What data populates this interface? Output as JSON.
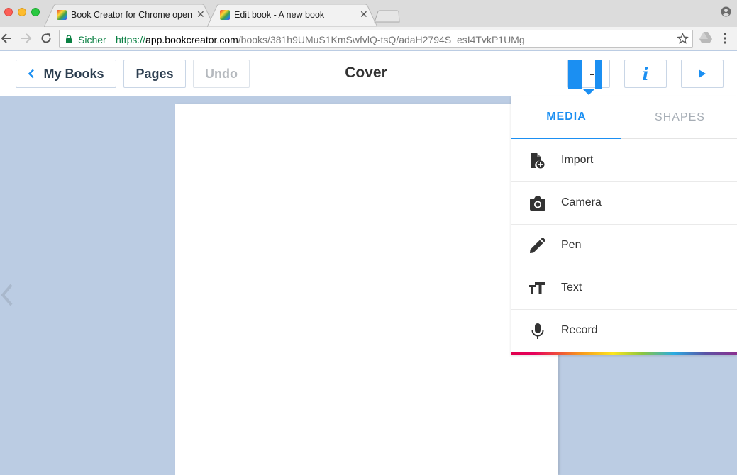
{
  "browser": {
    "tabs": [
      {
        "title": "Book Creator for Chrome open",
        "active": false
      },
      {
        "title": "Edit book - A new book",
        "active": true
      }
    ],
    "address": {
      "secure_label": "Sicher",
      "url_scheme": "https://",
      "url_host": "app.bookcreator.com",
      "url_path": "/books/381h9UMuS1KmSwfvlQ-tsQ/adaH2794S_esI4TvkP1UMg"
    }
  },
  "header": {
    "back_label": "My Books",
    "pages_label": "Pages",
    "undo_label": "Undo",
    "title": "Cover"
  },
  "panel": {
    "tabs": [
      {
        "label": "MEDIA",
        "active": true
      },
      {
        "label": "SHAPES",
        "active": false
      }
    ],
    "items": [
      {
        "label": "Import",
        "icon": "import-file-icon"
      },
      {
        "label": "Camera",
        "icon": "camera-icon"
      },
      {
        "label": "Pen",
        "icon": "pen-icon"
      },
      {
        "label": "Text",
        "icon": "text-icon"
      },
      {
        "label": "Record",
        "icon": "microphone-icon"
      }
    ]
  },
  "colors": {
    "accent": "#1b8ff2",
    "canvas_background": "#bbcce3"
  }
}
